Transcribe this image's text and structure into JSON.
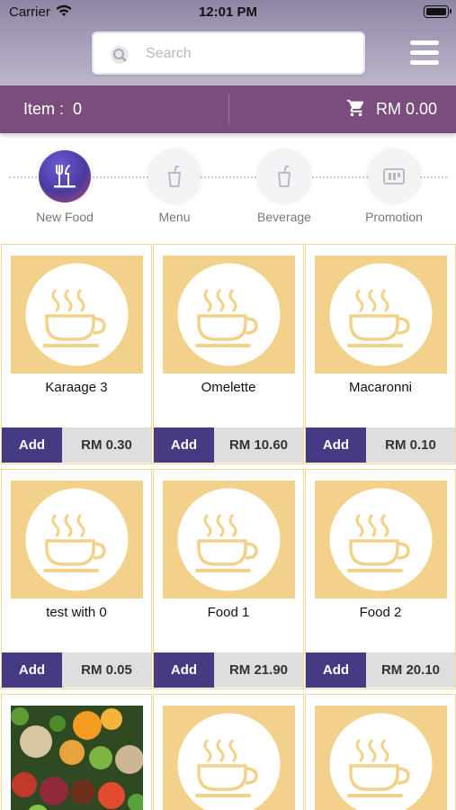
{
  "status_bar": {
    "carrier": "Carrier",
    "time": "12:01 PM"
  },
  "search": {
    "placeholder": "Search",
    "value": ""
  },
  "cart_bar": {
    "item_label": "Item :  0",
    "total": "RM 0.00"
  },
  "categories": [
    {
      "label": "New Food",
      "icon": "utensils-icon",
      "active": true
    },
    {
      "label": "Menu",
      "icon": "drink-cup-icon",
      "active": false
    },
    {
      "label": "Beverage",
      "icon": "drink-cup-icon",
      "active": false
    },
    {
      "label": "Promotion",
      "icon": "promotion-icon",
      "active": false
    }
  ],
  "add_label": "Add",
  "products": [
    {
      "name": "Karaage 3",
      "price": "RM 0.30",
      "image": "coffee-cup-icon"
    },
    {
      "name": "Omelette",
      "price": "RM 10.60",
      "image": "coffee-cup-icon"
    },
    {
      "name": "Macaronni",
      "price": "RM 0.10",
      "image": "coffee-cup-icon"
    },
    {
      "name": "test with 0",
      "price": "RM 0.05",
      "image": "coffee-cup-icon"
    },
    {
      "name": "Food 1",
      "price": "RM 21.90",
      "image": "coffee-cup-icon"
    },
    {
      "name": "Food 2",
      "price": "RM 20.10",
      "image": "coffee-cup-icon"
    },
    {
      "name": "",
      "price": "",
      "image": "vegetables-photo"
    },
    {
      "name": "",
      "price": "",
      "image": "coffee-cup-icon"
    },
    {
      "name": "",
      "price": "",
      "image": "coffee-cup-icon"
    }
  ],
  "colors": {
    "header_bar": "#7a4d7c",
    "add_button": "#463a83",
    "thumb_bg": "#f2d28a",
    "card_border": "#f1d79a"
  }
}
